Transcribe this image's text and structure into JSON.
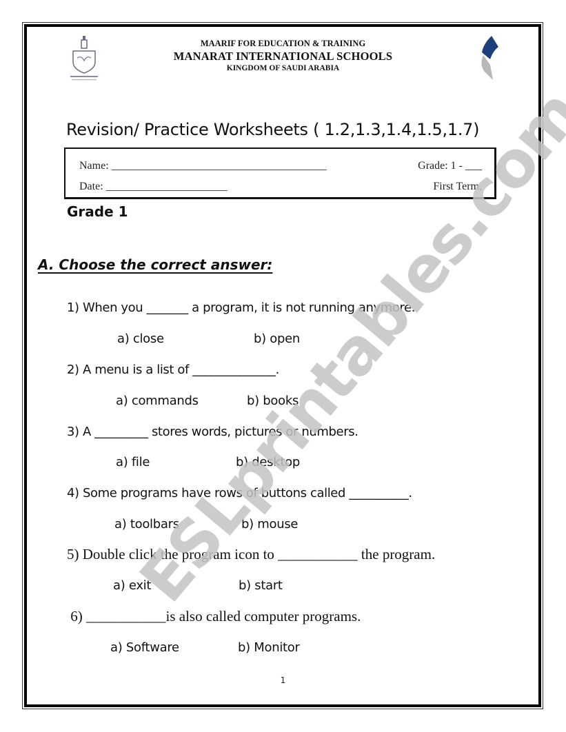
{
  "header": {
    "org_line_1": "MAARIF FOR EDUCATION & TRAINING",
    "org_line_2": "MANARAT INTERNATIONAL SCHOOLS",
    "org_line_3": "KINGDOM OF SAUDI ARABIA",
    "logo_left": "manarat-schools-crest-icon",
    "logo_right": "maarif-logo-icon",
    "colors": {
      "logo_blue": "#1d3f7a",
      "logo_gray": "#b8b8b8"
    }
  },
  "title": "Revision/ Practice Worksheets ( 1.2,1.3,1.4,1.5,1.7)",
  "info_box": {
    "name_label": "Name: _______________________________________",
    "grade_label": "Grade:  1 - ___",
    "date_label": "Date: ______________________",
    "term_label": "First Term,"
  },
  "grade_heading": "Grade 1",
  "section": {
    "heading": "A. Choose the correct answer:",
    "questions": [
      {
        "text": "1) When you _______ a program, it is not running anymore.",
        "option_a": "a) close",
        "option_b": "b) open"
      },
      {
        "text": "2) A menu is a list of ______________.",
        "option_a": "a) commands",
        "option_b": "b) books"
      },
      {
        "text": "3) A _________ stores words, pictures or numbers.",
        "option_a": "a) file",
        "option_b": "b) desktop"
      },
      {
        "text": "4) Some programs have rows of buttons called __________.",
        "option_a": "a) toolbars",
        "option_b": "b) mouse"
      },
      {
        "text": "5) Double click the program icon to ___________ the program.",
        "option_a": "a) exit",
        "option_b": "b) start"
      },
      {
        "text": " 6) ___________is also called computer programs.",
        "option_a": "a) Software",
        "option_b": "b) Monitor"
      }
    ]
  },
  "page_number": "1",
  "watermark": "ESLprintables.com"
}
